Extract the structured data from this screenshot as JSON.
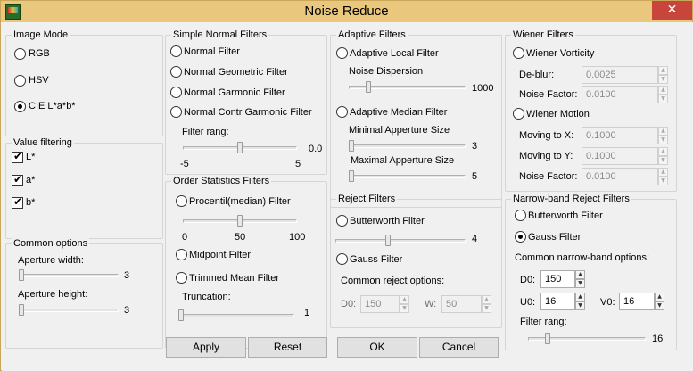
{
  "window": {
    "title": "Noise Reduce",
    "close_glyph": "✕"
  },
  "image_mode": {
    "title": "Image Mode",
    "options": [
      {
        "label": "RGB",
        "checked": false
      },
      {
        "label": "HSV",
        "checked": false
      },
      {
        "label": "CIE L*a*b*",
        "checked": true
      }
    ]
  },
  "value_filtering": {
    "title": "Value filtering",
    "channels": [
      {
        "label": "L*",
        "checked": true
      },
      {
        "label": "a*",
        "checked": true
      },
      {
        "label": "b*",
        "checked": true
      }
    ]
  },
  "common_options": {
    "title": "Common options",
    "aperture_width": {
      "label": "Aperture width:",
      "value": "3",
      "fraction": 0.0
    },
    "aperture_height": {
      "label": "Aperture height:",
      "value": "3",
      "fraction": 0.0
    }
  },
  "simple_normal": {
    "title": "Simple Normal Filters",
    "options": [
      {
        "label": "Normal Filter",
        "checked": false
      },
      {
        "label": "Normal Geometric Filter",
        "checked": false
      },
      {
        "label": "Normal Garmonic Filter",
        "checked": false
      },
      {
        "label": "Normal Contr Garmonic Filter",
        "checked": false
      }
    ],
    "filter_rang": {
      "label": "Filter rang:",
      "value": "0.0",
      "min": "-5",
      "max": "5",
      "fraction": 0.5
    }
  },
  "order_statistics": {
    "title": "Order Statistics Filters",
    "procentil": {
      "label": "Procentil(median) Filter",
      "checked": false,
      "min": "0",
      "mid": "50",
      "max": "100",
      "fraction": 0.5
    },
    "midpoint": {
      "label": "Midpoint Filter",
      "checked": false
    },
    "trimmed": {
      "label": "Trimmed Mean Filter",
      "checked": false
    },
    "truncation": {
      "label": "Truncation:",
      "value": "1",
      "fraction": 0.0
    }
  },
  "adaptive": {
    "title": "Adaptive Filters",
    "local": {
      "label": "Adaptive Local Filter",
      "checked": false
    },
    "noise_dispersion": {
      "label": "Noise Dispersion",
      "value": "1000",
      "fraction": 0.15
    },
    "median": {
      "label": "Adaptive Median Filter",
      "checked": false
    },
    "min_aperture": {
      "label": "Minimal Apperture Size",
      "value": "3",
      "fraction": 0.0
    },
    "max_aperture": {
      "label": "Maximal Apperture Size",
      "value": "5",
      "fraction": 0.0
    }
  },
  "reject": {
    "title": "Reject Filters",
    "butterworth": {
      "label": "Butterworth Filter",
      "checked": false,
      "value": "4",
      "fraction": 0.4
    },
    "gauss": {
      "label": "Gauss Filter",
      "checked": false
    },
    "common_label": "Common reject options:",
    "d0": {
      "label": "D0:",
      "value": "150"
    },
    "w": {
      "label": "W:",
      "value": "50"
    }
  },
  "wiener": {
    "title": "Wiener Filters",
    "vorticity": {
      "label": "Wiener Vorticity",
      "checked": false
    },
    "deblur": {
      "label": "De-blur:",
      "value": "0.0025"
    },
    "noise_factor_1": {
      "label": "Noise Factor:",
      "value": "0.0100"
    },
    "motion": {
      "label": "Wiener Motion",
      "checked": false
    },
    "moving_x": {
      "label": "Moving to X:",
      "value": "0.1000"
    },
    "moving_y": {
      "label": "Moving to Y:",
      "value": "0.1000"
    },
    "noise_factor_2": {
      "label": "Noise Factor:",
      "value": "0.0100"
    }
  },
  "narrow_band": {
    "title": "Narrow-band Reject Filters",
    "butterworth": {
      "label": "Butterworth Filter",
      "checked": false
    },
    "gauss": {
      "label": "Gauss Filter",
      "checked": true
    },
    "common_label": "Common narrow-band options:",
    "d0": {
      "label": "D0:",
      "value": "150"
    },
    "u0": {
      "label": "U0:",
      "value": "16"
    },
    "v0": {
      "label": "V0:",
      "value": "16"
    },
    "filter_rang": {
      "label": "Filter rang:",
      "value": "16",
      "fraction": 0.15
    }
  },
  "buttons": {
    "apply": "Apply",
    "reset": "Reset",
    "ok": "OK",
    "cancel": "Cancel"
  }
}
